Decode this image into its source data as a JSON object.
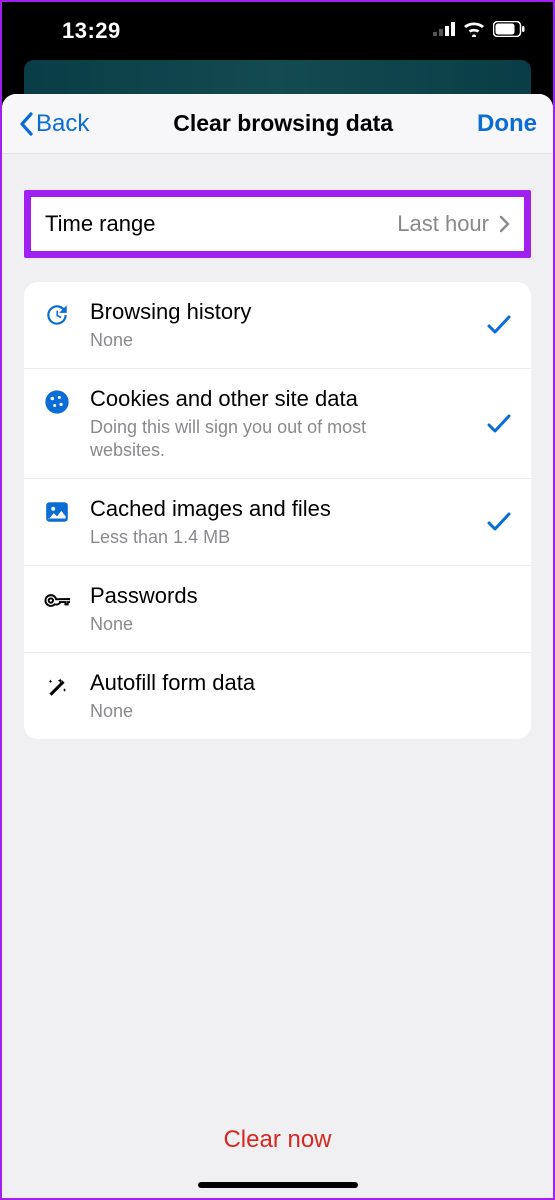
{
  "statusbar": {
    "time": "13:29"
  },
  "nav": {
    "back": "Back",
    "title": "Clear browsing data",
    "done": "Done"
  },
  "time_range": {
    "label": "Time range",
    "value": "Last hour"
  },
  "items": [
    {
      "icon": "history",
      "title": "Browsing history",
      "sub": "None",
      "checked": true
    },
    {
      "icon": "cookie",
      "title": "Cookies and other site data",
      "sub": "Doing this will sign you out of most websites.",
      "checked": true
    },
    {
      "icon": "image",
      "title": "Cached images and files",
      "sub": "Less than 1.4 MB",
      "checked": true
    },
    {
      "icon": "key",
      "title": "Passwords",
      "sub": "None",
      "checked": false
    },
    {
      "icon": "wand",
      "title": "Autofill form data",
      "sub": "None",
      "checked": false
    }
  ],
  "action": {
    "clear": "Clear now"
  }
}
